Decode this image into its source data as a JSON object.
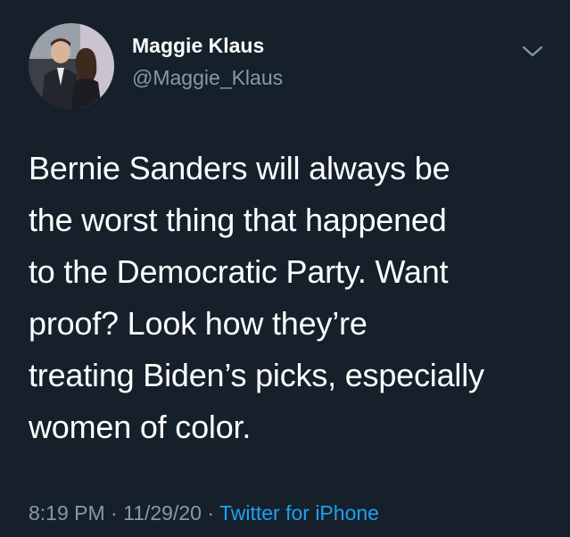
{
  "user": {
    "display_name": "Maggie Klaus",
    "handle": "@Maggie_Klaus",
    "avatar_icon": "profile-photo"
  },
  "menu_icon": "chevron-down-icon",
  "tweet": {
    "lines": [
      "Bernie Sanders will always be",
      "the worst thing that happened",
      "to the Democratic Party. Want",
      "proof? Look how they’re",
      "treating Biden’s picks, especially",
      "women of color."
    ]
  },
  "meta": {
    "time": "8:19 PM",
    "date": "11/29/20",
    "separator": " · ",
    "source": "Twitter for iPhone"
  },
  "colors": {
    "background": "#15202b",
    "secondary_text": "#8899a6",
    "link": "#1da1f2"
  }
}
